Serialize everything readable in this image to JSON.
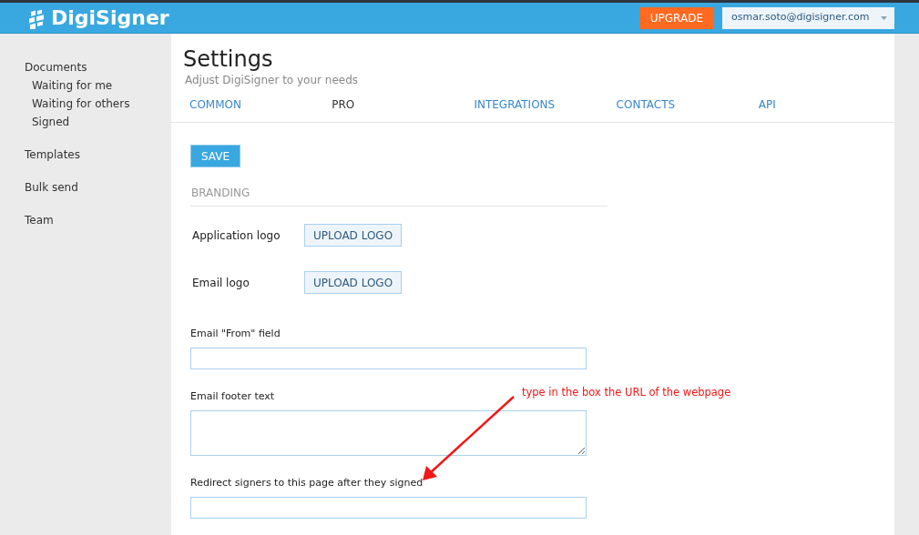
{
  "header": {
    "logo": "DigiSigner",
    "upgrade": "UPGRADE",
    "account": "osmar.soto@digisigner.com"
  },
  "sidebar": {
    "items": [
      {
        "label": "Documents",
        "children": [
          {
            "label": "Waiting for me"
          },
          {
            "label": "Waiting for others"
          },
          {
            "label": "Signed"
          }
        ]
      },
      {
        "label": "Templates"
      },
      {
        "label": "Bulk send"
      },
      {
        "label": "Team"
      }
    ]
  },
  "page": {
    "title": "Settings",
    "subtitle": "Adjust DigiSigner to your needs"
  },
  "tabs": [
    {
      "label": "COMMON",
      "selected": false
    },
    {
      "label": "PRO",
      "selected": true
    },
    {
      "label": "INTEGRATIONS",
      "selected": false
    },
    {
      "label": "CONTACTS",
      "selected": false
    },
    {
      "label": "API",
      "selected": false
    }
  ],
  "save": "SAVE",
  "section": "BRANDING",
  "fields": [
    {
      "kind": "upload",
      "label": "Application logo",
      "button": "UPLOAD LOGO"
    },
    {
      "kind": "upload",
      "label": "Email logo",
      "button": "UPLOAD LOGO"
    },
    {
      "kind": "input",
      "label": "Email \"From\" field"
    },
    {
      "kind": "textarea",
      "label": "Email footer text"
    },
    {
      "kind": "input",
      "label": "Redirect signers to this page after they signed"
    }
  ],
  "annotation": "type in the box the URL of the webpage"
}
